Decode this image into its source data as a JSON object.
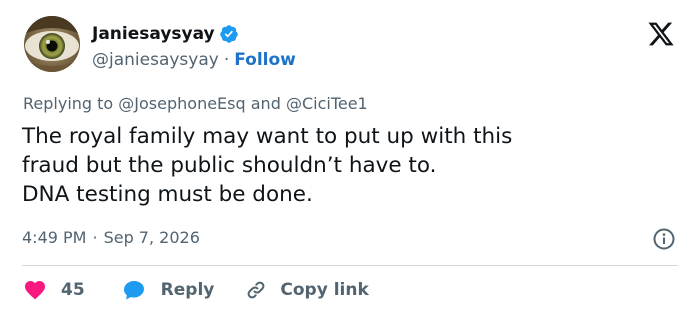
{
  "author": {
    "display_name": "Janiesaysyay",
    "handle": "@janiesaysyay",
    "separator": "·",
    "follow_label": "Follow",
    "verified": true,
    "avatar_icon": "eye-photo",
    "verified_color": "#1d9bf0"
  },
  "reply_context": {
    "prefix": "Replying to",
    "mention_1": "@JosephoneEsq",
    "conjunction": "and",
    "mention_2": "@CiciTee1"
  },
  "tweet": {
    "lines": [
      "The royal family may want to put up with this",
      "fraud but the public shouldn’t have to.",
      "DNA testing must be done."
    ]
  },
  "meta": {
    "time": "4:49 PM",
    "separator": "·",
    "date": "Sep 7, 2026"
  },
  "actions": {
    "like_count": "45",
    "reply_label": "Reply",
    "copy_label": "Copy link"
  },
  "colors": {
    "like": "#f91880",
    "reply": "#1d9bf0",
    "link": "#1d73c9",
    "muted": "#536471",
    "text": "#0f1419"
  },
  "icons": {
    "brand": "x-logo-icon",
    "info": "info-icon",
    "like": "heart-icon",
    "reply": "speech-bubble-icon",
    "copy": "link-icon"
  }
}
